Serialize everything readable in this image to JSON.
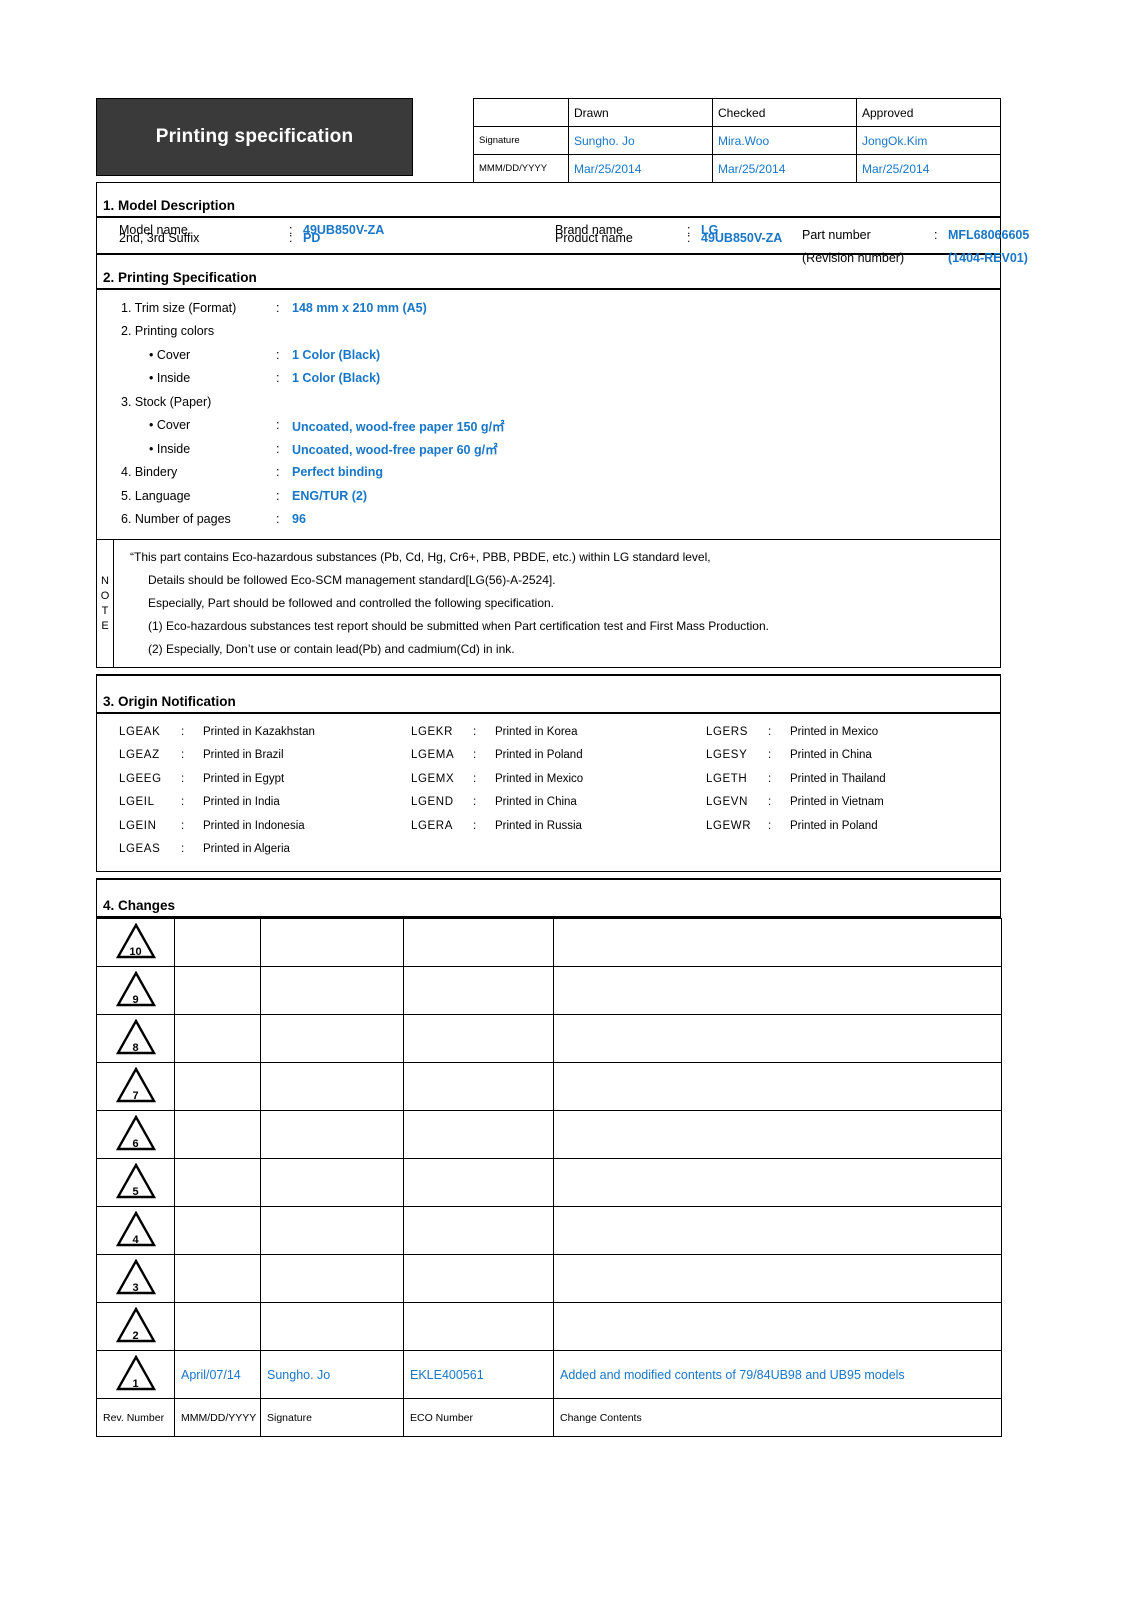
{
  "header": {
    "title": "Printing specification",
    "signature_table": {
      "columns": [
        "",
        "Drawn",
        "Checked",
        "Approved"
      ],
      "rows": [
        {
          "label": "Signature",
          "values": [
            "Sungho. Jo",
            "Mira.Woo",
            "JongOk.Kim"
          ]
        },
        {
          "label": "MMM/DD/YYYY",
          "values": [
            "Mar/25/2014",
            "Mar/25/2014",
            "Mar/25/2014"
          ]
        }
      ]
    }
  },
  "section1": {
    "heading": "1. Model Description",
    "fields": [
      {
        "label": "Model name",
        "colon": ":",
        "value": "49UB850V-ZA"
      },
      {
        "label": "Brand name",
        "colon": ":",
        "value": "LG"
      },
      {
        "label": "Part number",
        "colon": ":",
        "value": "MFL68066605"
      },
      {
        "label": "2nd, 3rd Suffix",
        "colon": ":",
        "value": "PD"
      },
      {
        "label": "Product name",
        "colon": ":",
        "value": "49UB850V-ZA"
      },
      {
        "label": "(Revision number)",
        "colon": "",
        "value": "(1404-REV01)"
      }
    ]
  },
  "section2": {
    "heading": "2. Printing Specification",
    "items": [
      {
        "label": "1. Trim size (Format)",
        "colon": ":",
        "value": "148 mm x 210 mm (A5)",
        "indent": false
      },
      {
        "label": "2. Printing colors",
        "colon": "",
        "value": "",
        "indent": false
      },
      {
        "label": "• Cover",
        "colon": ":",
        "value": "1 Color (Black)",
        "indent": true
      },
      {
        "label": "• Inside",
        "colon": ":",
        "value": "1 Color (Black)",
        "indent": true
      },
      {
        "label": "3. Stock (Paper)",
        "colon": "",
        "value": "",
        "indent": false
      },
      {
        "label": "• Cover",
        "colon": ":",
        "value": "Uncoated, wood-free paper 150 g/㎡",
        "indent": true
      },
      {
        "label": "• Inside",
        "colon": ":",
        "value": "Uncoated, wood-free paper 60 g/㎡",
        "indent": true
      },
      {
        "label": "4. Bindery",
        "colon": ":",
        "value": "Perfect binding",
        "indent": false
      },
      {
        "label": "5. Language",
        "colon": ":",
        "value": "ENG/TUR (2)",
        "indent": false
      },
      {
        "label": "6. Number of pages",
        "colon": ":",
        "value": "96",
        "indent": false
      }
    ]
  },
  "note": {
    "tab_label": "NOTE",
    "lines": [
      {
        "text": "“This part contains Eco-hazardous substances (Pb, Cd, Hg, Cr6+, PBB, PBDE, etc.) within LG standard level,",
        "indent": false
      },
      {
        "text": "Details should be followed Eco-SCM management standard[LG(56)-A-2524].",
        "indent": true
      },
      {
        "text": "Especially, Part should be followed and controlled the following specification.",
        "indent": true
      },
      {
        "text": "(1) Eco-hazardous substances test report should be submitted when Part certification test and First Mass Production.",
        "indent": true
      },
      {
        "text": "(2) Especially, Don’t use or contain lead(Pb) and cadmium(Cd) in ink.",
        "indent": true
      }
    ]
  },
  "section3": {
    "heading": "3. Origin Notification",
    "entries": [
      {
        "code": "LGEAK",
        "colon": ":",
        "text": "Printed in Kazakhstan"
      },
      {
        "code": "LGEKR",
        "colon": ":",
        "text": "Printed in Korea"
      },
      {
        "code": "LGERS",
        "colon": ":",
        "text": "Printed in Mexico"
      },
      {
        "code": "LGEAZ",
        "colon": ":",
        "text": "Printed in Brazil"
      },
      {
        "code": "LGEMA",
        "colon": ":",
        "text": "Printed in Poland"
      },
      {
        "code": "LGESY",
        "colon": ":",
        "text": "Printed in China"
      },
      {
        "code": "LGEEG",
        "colon": ":",
        "text": "Printed in Egypt"
      },
      {
        "code": "LGEMX",
        "colon": ":",
        "text": "Printed in Mexico"
      },
      {
        "code": "LGETH",
        "colon": ":",
        "text": "Printed in Thailand"
      },
      {
        "code": "LGEIL",
        "colon": ":",
        "text": "Printed in India"
      },
      {
        "code": "LGEND",
        "colon": ":",
        "text": "Printed in China"
      },
      {
        "code": "LGEVN",
        "colon": ":",
        "text": "Printed in Vietnam"
      },
      {
        "code": "LGEIN",
        "colon": ":",
        "text": "Printed in Indonesia"
      },
      {
        "code": "LGERA",
        "colon": ":",
        "text": "Printed in Russia"
      },
      {
        "code": "LGEWR",
        "colon": ":",
        "text": "Printed in Poland"
      },
      {
        "code": "LGEAS",
        "colon": ":",
        "text": "Printed in Algeria"
      },
      {
        "code": "",
        "colon": "",
        "text": ""
      },
      {
        "code": "",
        "colon": "",
        "text": ""
      }
    ]
  },
  "section4": {
    "heading": "4. Changes",
    "rows": [
      {
        "rev": "10",
        "date": "",
        "signature": "",
        "eco": "",
        "contents": ""
      },
      {
        "rev": "9",
        "date": "",
        "signature": "",
        "eco": "",
        "contents": ""
      },
      {
        "rev": "8",
        "date": "",
        "signature": "",
        "eco": "",
        "contents": ""
      },
      {
        "rev": "7",
        "date": "",
        "signature": "",
        "eco": "",
        "contents": ""
      },
      {
        "rev": "6",
        "date": "",
        "signature": "",
        "eco": "",
        "contents": ""
      },
      {
        "rev": "5",
        "date": "",
        "signature": "",
        "eco": "",
        "contents": ""
      },
      {
        "rev": "4",
        "date": "",
        "signature": "",
        "eco": "",
        "contents": ""
      },
      {
        "rev": "3",
        "date": "",
        "signature": "",
        "eco": "",
        "contents": ""
      },
      {
        "rev": "2",
        "date": "",
        "signature": "",
        "eco": "",
        "contents": ""
      },
      {
        "rev": "1",
        "date": "April/07/14",
        "signature": "Sungho. Jo",
        "eco": "EKLE400561",
        "contents": "Added and modified contents of 79/84UB98 and UB95 models"
      }
    ],
    "footer": {
      "rev": "Rev. Number",
      "date": "MMM/DD/YYYY",
      "signature": "Signature",
      "eco": "ECO Number",
      "contents": "Change Contents"
    }
  },
  "colors": {
    "accent_blue": "#1876c8",
    "title_bar": "#3a3a3a",
    "rule": "#000000"
  }
}
